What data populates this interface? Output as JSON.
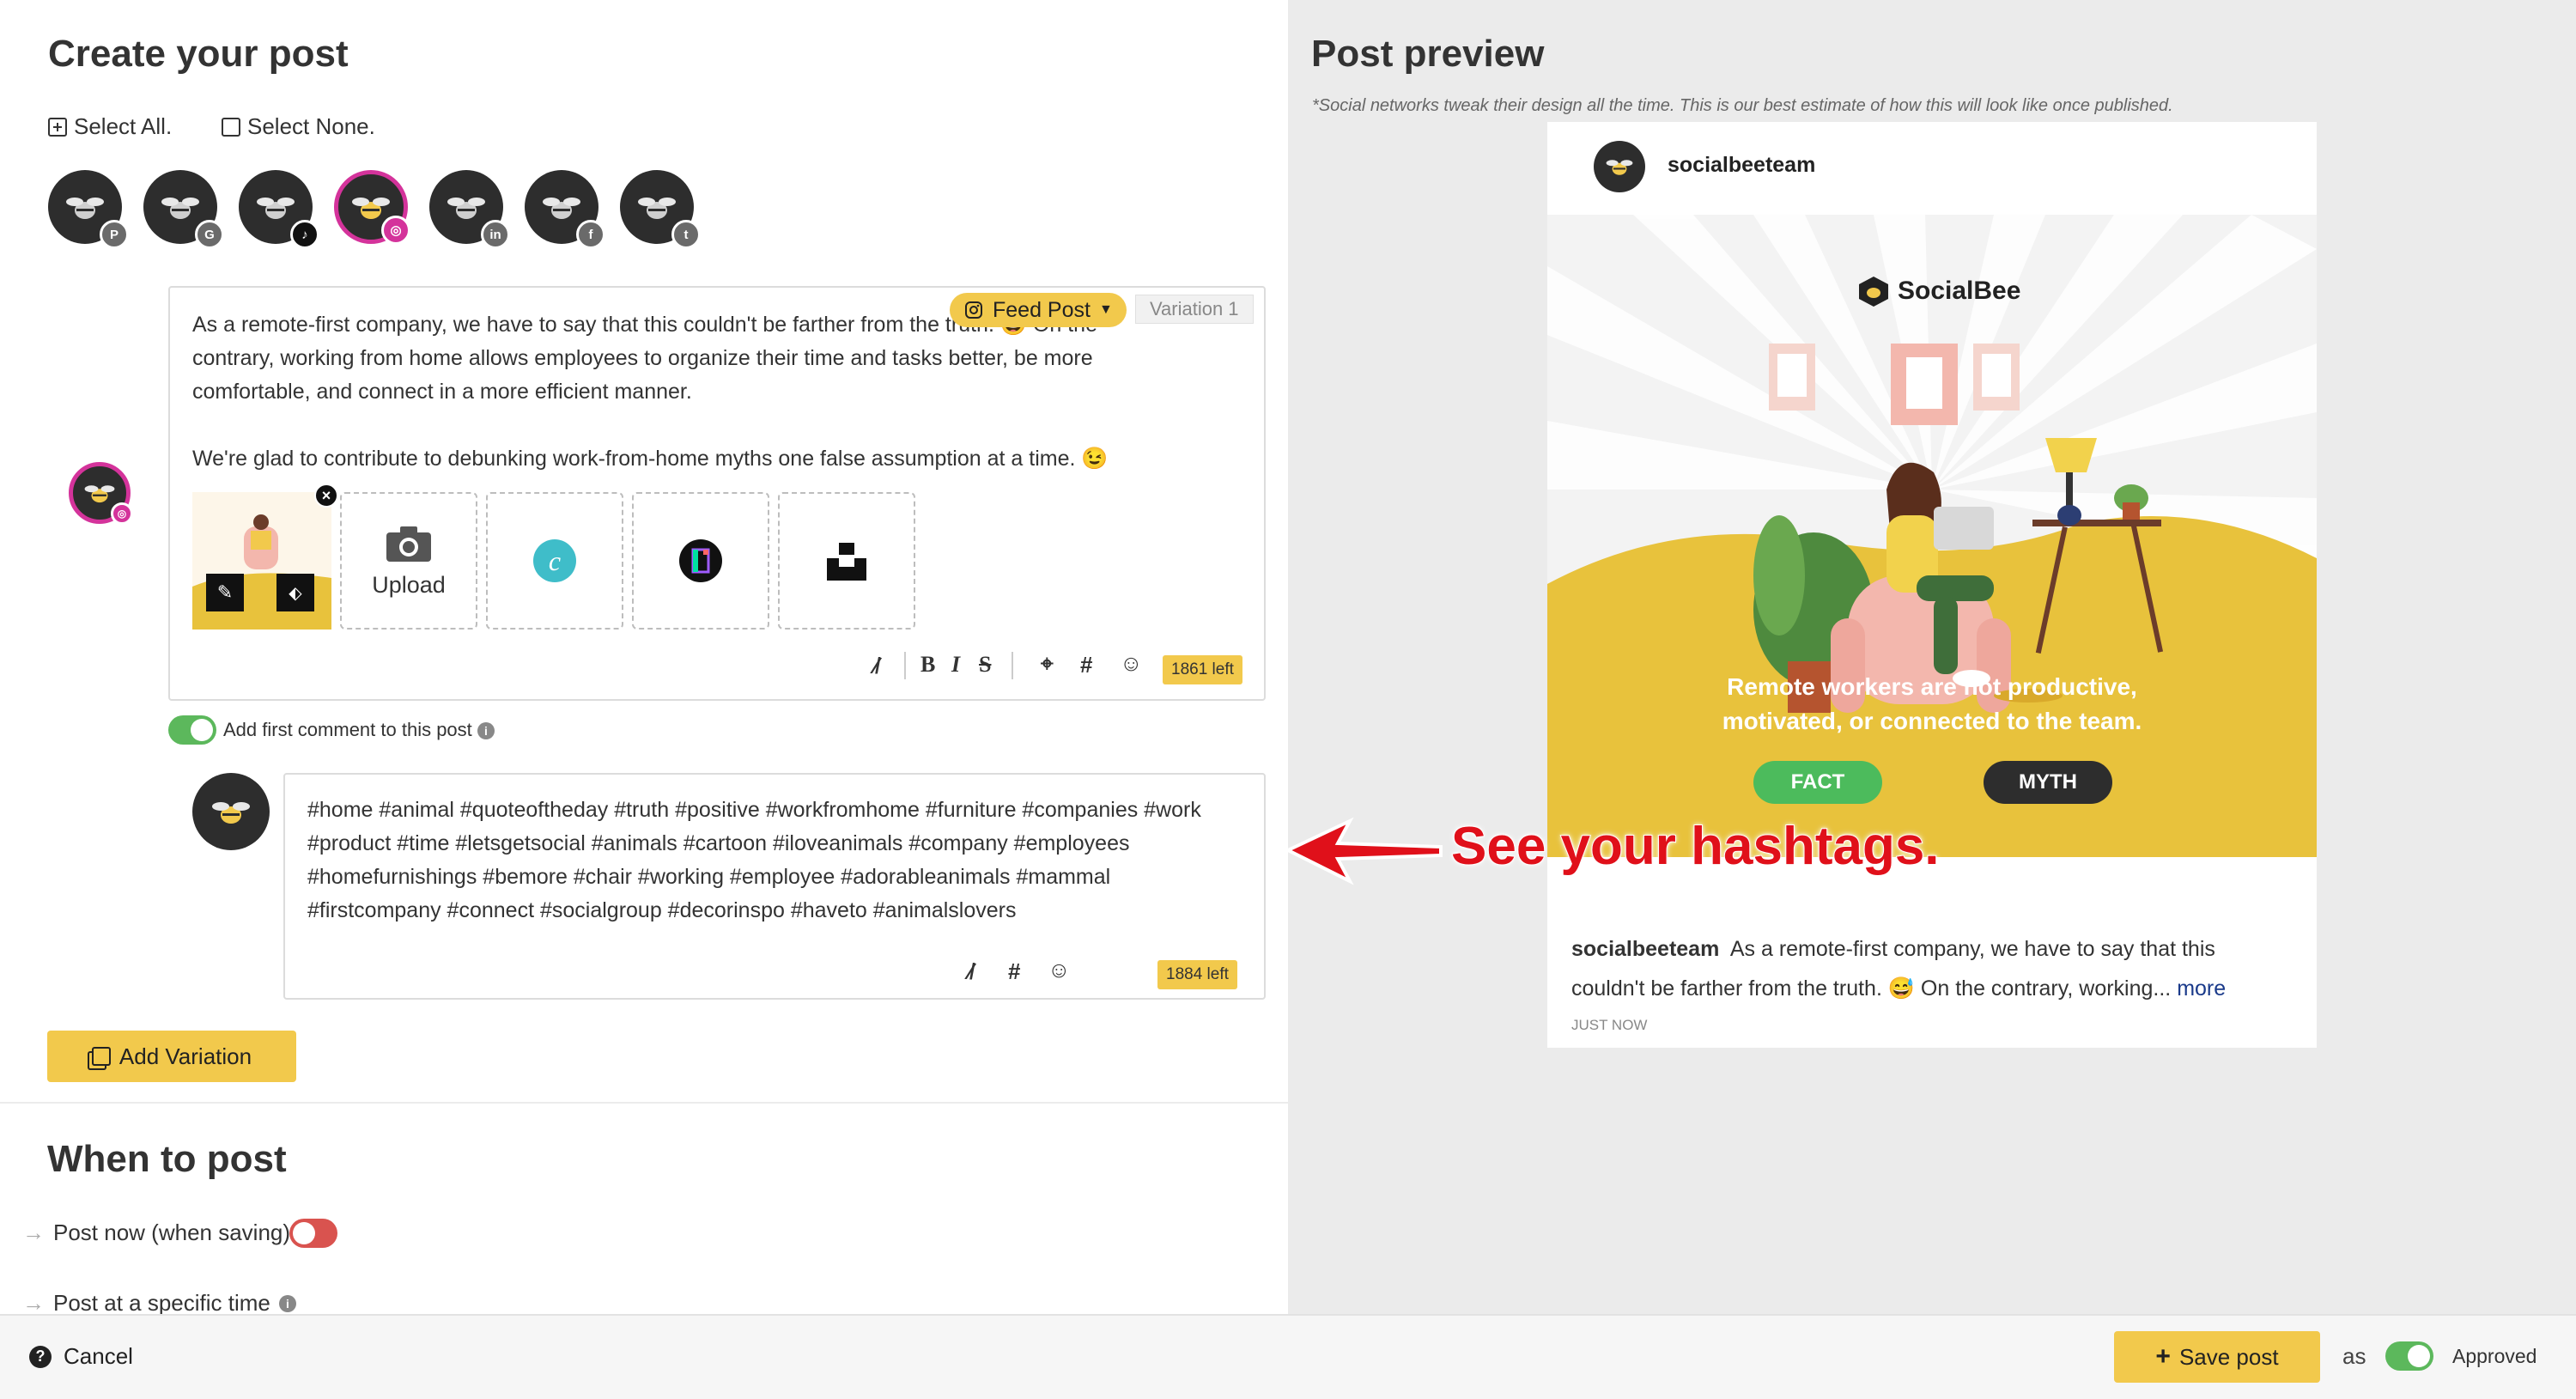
{
  "create": {
    "title": "Create your post",
    "select_all": "Select All.",
    "select_none": "Select None."
  },
  "profiles": [
    {
      "network": "pinterest",
      "badge": "P",
      "active": false
    },
    {
      "network": "google-business",
      "badge": "G",
      "active": false
    },
    {
      "network": "tiktok",
      "badge": "♪",
      "active": false
    },
    {
      "network": "instagram",
      "badge": "◎",
      "active": true
    },
    {
      "network": "linkedin",
      "badge": "in",
      "active": false
    },
    {
      "network": "facebook",
      "badge": "f",
      "active": false
    },
    {
      "network": "twitter",
      "badge": "t",
      "active": false
    }
  ],
  "editor": {
    "post_type": "Feed Post",
    "variation": "Variation 1",
    "paragraph1": "As a remote-first company, we have to say that this couldn't be farther from the truth. 😅 On the contrary, working from home allows employees to organize their time and tasks better, be more comfortable, and connect in a more efficient manner.",
    "paragraph2": "We're glad to contribute to debunking work-from-home myths one false assumption at a time. 😉",
    "upload_label": "Upload",
    "chars_left": "1861 left"
  },
  "first_comment": {
    "toggle_label": "Add first comment to this post",
    "enabled": true,
    "text": "#home #animal #quoteoftheday #truth #positive #workfromhome #furniture #companies #work #product #time #letsgetsocial #animals #cartoon #iloveanimals #company #employees #homefurnishings #bemore #chair #working #employee #adorableanimals #mammal #firstcompany #connect #socialgroup #decorinspo #haveto #animalslovers",
    "chars_left": "1884 left"
  },
  "add_variation_label": "Add Variation",
  "when": {
    "title": "When to post",
    "post_now_label": "Post now (when saving)",
    "post_now_enabled": false,
    "specific_time_label": "Post at a specific time"
  },
  "preview": {
    "title": "Post preview",
    "disclaimer": "*Social networks tweak their design all the time. This is our best estimate of how this will look like once published.",
    "username": "socialbeeteam",
    "brand": "SocialBee",
    "image_headline": "Remote workers are not productive, motivated, or connected to the team.",
    "fact_label": "FACT",
    "myth_label": "MYTH",
    "caption": "As a remote-first company, we have to say that this couldn't be farther from the truth. 😅 On the contrary, working...",
    "more_label": "more",
    "time_label": "JUST NOW"
  },
  "annotation": {
    "text": "See your hashtags."
  },
  "footer": {
    "cancel_label": "Cancel",
    "save_label": "Save post",
    "as_label": "as",
    "approved_label": "Approved",
    "approved_enabled": true
  },
  "colors": {
    "accent_yellow": "#f2c94c",
    "instagram_pink": "#d4339b",
    "toggle_green": "#5cb85c",
    "toggle_red": "#d9534f",
    "annotation_red": "#e0101a",
    "fact_green": "#4cbb5c",
    "myth_dark": "#2d2d2d"
  }
}
